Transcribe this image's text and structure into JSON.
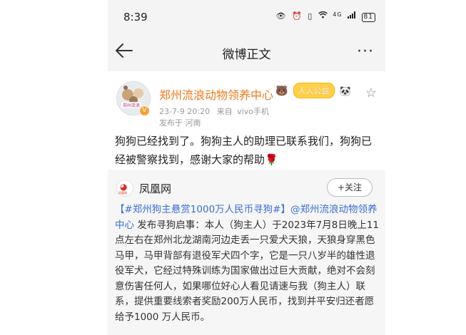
{
  "status_bar": {
    "time": "8:39",
    "icons": [
      "eye-icon",
      "alarm-icon",
      "vibrate-icon",
      "wifi-icon",
      "signal-icon"
    ],
    "network": "4G",
    "battery": "81"
  },
  "nav": {
    "title": "微博正文",
    "more": "···"
  },
  "post": {
    "author": "郑州流浪动物领养中心",
    "avatar_label": "郑州流浪",
    "public_welfare_badge": "人人公益",
    "date": "23-7-9 20:20",
    "source_label": "来自",
    "source": "vivo手机",
    "location": "发布于 河南",
    "text": "狗狗已经找到了。狗狗主人的助理已联系我们，狗狗已经被警察找到，感谢大家的帮助",
    "emoji": "🌹"
  },
  "repost": {
    "source_name": "凤凰网",
    "source_logo_text": "凤凰网",
    "follow_label": "+关注",
    "hashtag": "【#郑州狗主悬赏1000万人民币寻狗#】",
    "mention": "@郑州流浪动物领养中心",
    "body": " 发布寻狗启事：本人（狗主人）于2023年7月8日晚上11点左右在郑州北龙湖南河边走丢一只爱犬天狼，天狼身穿黑色马甲，马甲背部有退役军犬四个字，它是一只八岁半的雄性退役军犬，它经过特殊训练为国家做出过巨大贡献，绝对不会刻意伤害任何人，如果哪位好心人看见请速与我（狗主人）联系，提供重要线索者奖励200万人民币，找到并平安归还者愿给予1000 万人民币。"
  },
  "colors": {
    "username": "#ee7b1e",
    "link": "#3b6fd2",
    "header_bg": "#f4f4f4",
    "repost_bg": "#f6f6f6"
  }
}
